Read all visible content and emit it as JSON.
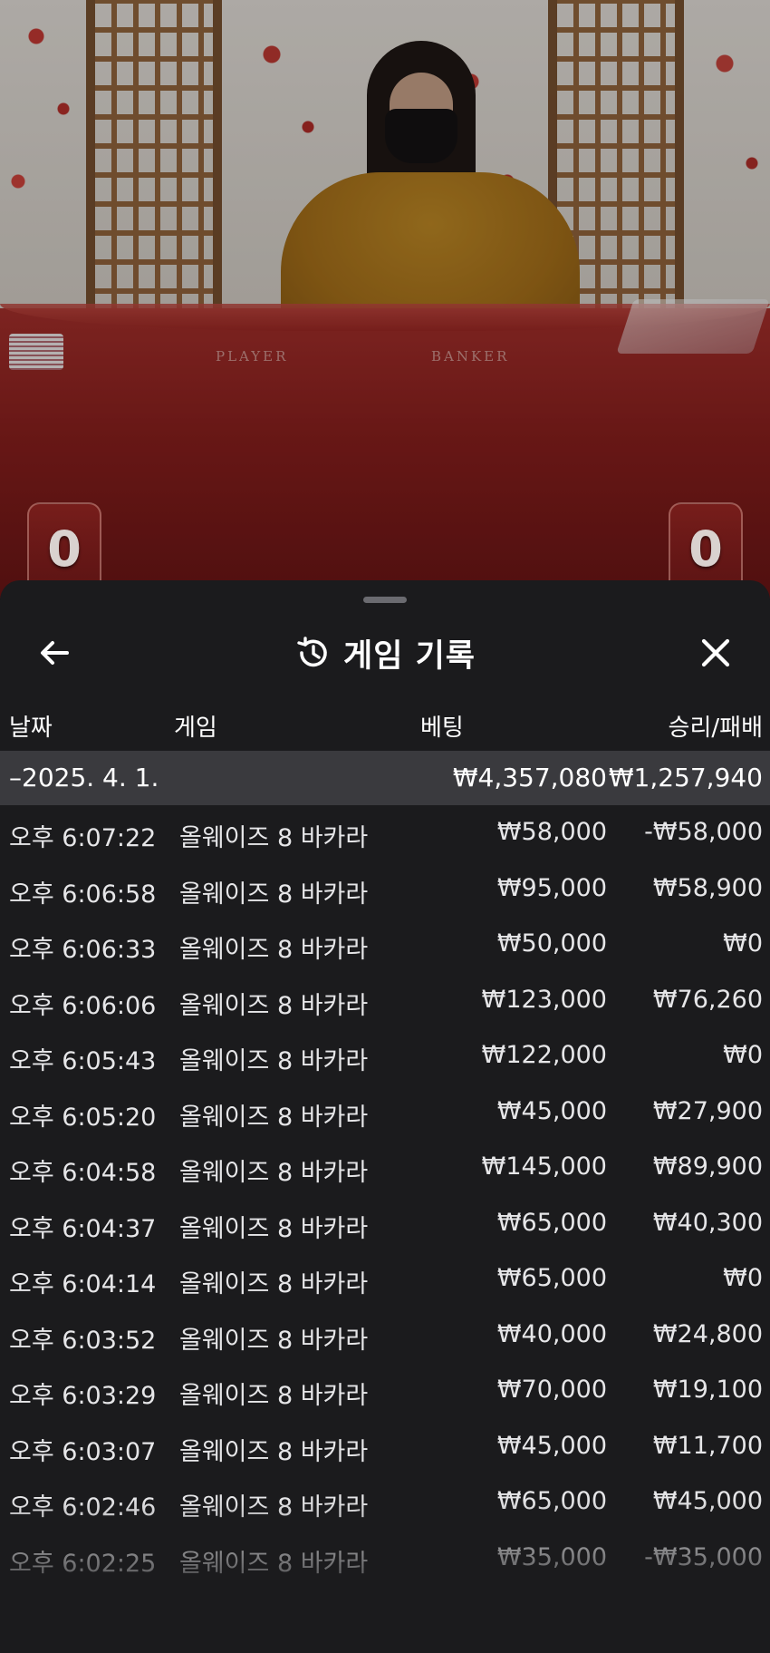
{
  "video": {
    "player_label": "PLAYER",
    "banker_label": "BANKER",
    "player_score": "0",
    "banker_score": "0"
  },
  "header": {
    "title": "게임 기록",
    "back_icon": "arrow-left-icon",
    "history_icon": "history-icon",
    "close_icon": "close-icon"
  },
  "columns": {
    "date": "날짜",
    "game": "게임",
    "bet": "베팅",
    "win_loss": "승리/패배"
  },
  "summary": {
    "date": "–2025. 4. 1.",
    "bet_total": "₩4,357,080",
    "win_total": "₩1,257,940"
  },
  "rows": [
    {
      "time": "오후 6:07:22",
      "game": "올웨이즈 8 바카라",
      "bet": "₩58,000",
      "win": "-₩58,000"
    },
    {
      "time": "오후 6:06:58",
      "game": "올웨이즈 8 바카라",
      "bet": "₩95,000",
      "win": "₩58,900"
    },
    {
      "time": "오후 6:06:33",
      "game": "올웨이즈 8 바카라",
      "bet": "₩50,000",
      "win": "₩0"
    },
    {
      "time": "오후 6:06:06",
      "game": "올웨이즈 8 바카라",
      "bet": "₩123,000",
      "win": "₩76,260"
    },
    {
      "time": "오후 6:05:43",
      "game": "올웨이즈 8 바카라",
      "bet": "₩122,000",
      "win": "₩0"
    },
    {
      "time": "오후 6:05:20",
      "game": "올웨이즈 8 바카라",
      "bet": "₩45,000",
      "win": "₩27,900"
    },
    {
      "time": "오후 6:04:58",
      "game": "올웨이즈 8 바카라",
      "bet": "₩145,000",
      "win": "₩89,900"
    },
    {
      "time": "오후 6:04:37",
      "game": "올웨이즈 8 바카라",
      "bet": "₩65,000",
      "win": "₩40,300"
    },
    {
      "time": "오후 6:04:14",
      "game": "올웨이즈 8 바카라",
      "bet": "₩65,000",
      "win": "₩0"
    },
    {
      "time": "오후 6:03:52",
      "game": "올웨이즈 8 바카라",
      "bet": "₩40,000",
      "win": "₩24,800"
    },
    {
      "time": "오후 6:03:29",
      "game": "올웨이즈 8 바카라",
      "bet": "₩70,000",
      "win": "₩19,100"
    },
    {
      "time": "오후 6:03:07",
      "game": "올웨이즈 8 바카라",
      "bet": "₩45,000",
      "win": "₩11,700"
    },
    {
      "time": "오후 6:02:46",
      "game": "올웨이즈 8 바카라",
      "bet": "₩65,000",
      "win": "₩45,000"
    },
    {
      "time": "오후 6:02:25",
      "game": "올웨이즈 8 바카라",
      "bet": "₩35,000",
      "win": "-₩35,000"
    }
  ],
  "colors": {
    "sheet_bg": "#1b1b1d",
    "summary_bg": "#3a3a3e",
    "text": "#ffffff",
    "table_felt": "#8a1f1d"
  }
}
